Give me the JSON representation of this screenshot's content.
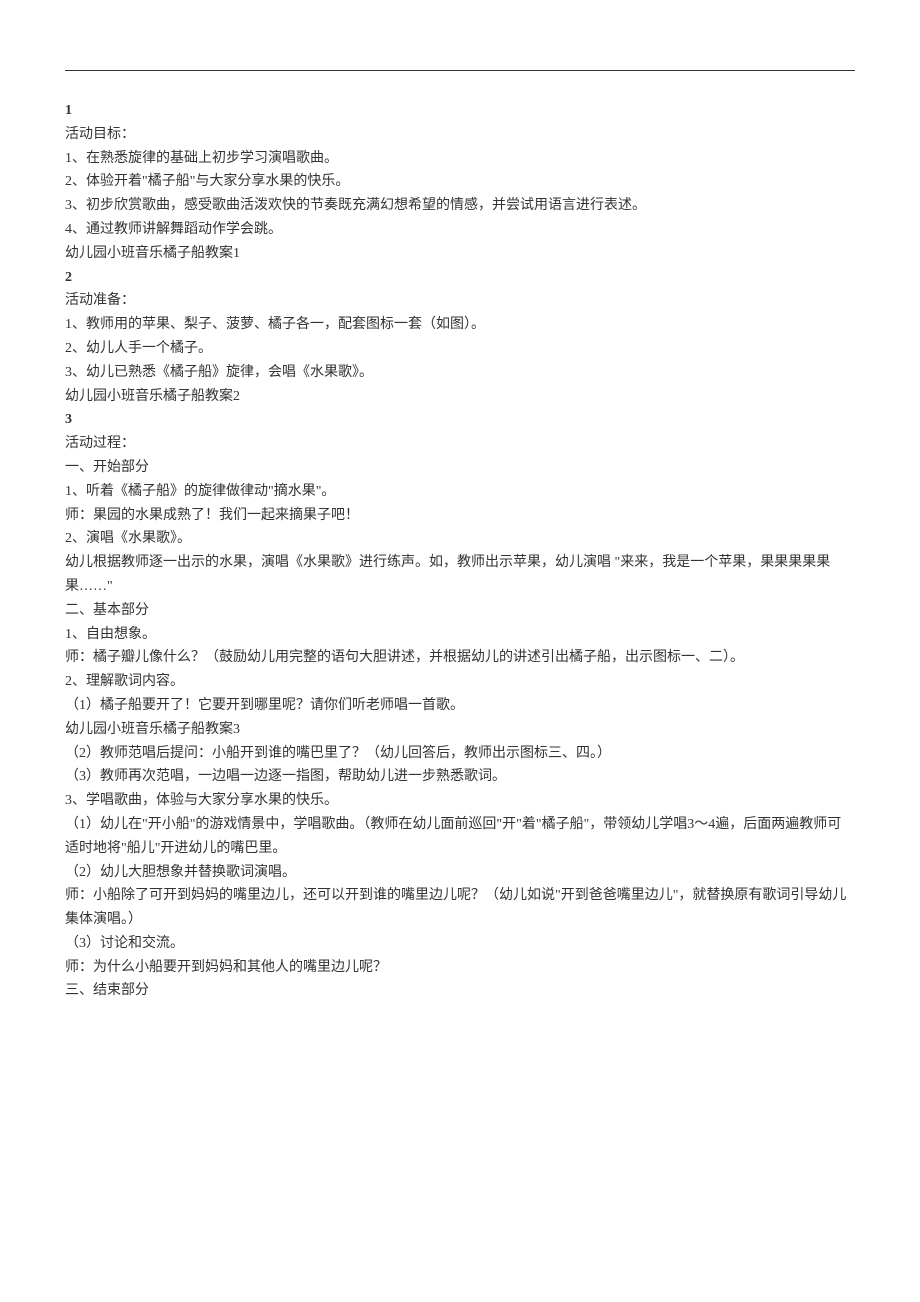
{
  "lines": [
    {
      "cls": "num",
      "text": "1"
    },
    {
      "text": "活动目标："
    },
    {
      "text": "1、在熟悉旋律的基础上初步学习演唱歌曲。"
    },
    {
      "text": "2、体验开着\"橘子船\"与大家分享水果的快乐。"
    },
    {
      "text": "3、初步欣赏歌曲，感受歌曲活泼欢快的节奏既充满幻想希望的情感，并尝试用语言进行表述。"
    },
    {
      "text": "4、通过教师讲解舞蹈动作学会跳。"
    },
    {
      "text": "幼儿园小班音乐橘子船教案1"
    },
    {
      "cls": "num",
      "text": "2"
    },
    {
      "text": "活动准备："
    },
    {
      "text": "1、教师用的苹果、梨子、菠萝、橘子各一，配套图标一套（如图）。"
    },
    {
      "text": "2、幼儿人手一个橘子。"
    },
    {
      "text": "3、幼儿已熟悉《橘子船》旋律，会唱《水果歌》。"
    },
    {
      "text": "幼儿园小班音乐橘子船教案2"
    },
    {
      "cls": "num",
      "text": "3"
    },
    {
      "text": "活动过程："
    },
    {
      "text": "一、开始部分"
    },
    {
      "text": "1、听着《橘子船》的旋律做律动\"摘水果\"。"
    },
    {
      "text": "师：果园的水果成熟了！我们一起来摘果子吧！"
    },
    {
      "text": "2、演唱《水果歌》。"
    },
    {
      "text": "幼儿根据教师逐一出示的水果，演唱《水果歌》进行练声。如，教师出示苹果，幼儿演唱 \"来来，我是一个苹果，果果果果果果……\""
    },
    {
      "text": "二、基本部分"
    },
    {
      "text": "1、自由想象。"
    },
    {
      "text": "师：橘子瓣儿像什么？（鼓励幼儿用完整的语句大胆讲述，并根据幼儿的讲述引出橘子船，出示图标一、二）。"
    },
    {
      "text": "2、理解歌词内容。"
    },
    {
      "text": "（1）橘子船要开了！它要开到哪里呢？请你们听老师唱一首歌。"
    },
    {
      "text": "幼儿园小班音乐橘子船教案3"
    },
    {
      "text": "（2）教师范唱后提问：小船开到谁的嘴巴里了？（幼儿回答后，教师出示图标三、四。）"
    },
    {
      "text": "（3）教师再次范唱，一边唱一边逐一指图，帮助幼儿进一步熟悉歌词。"
    },
    {
      "text": "3、学唱歌曲，体验与大家分享水果的快乐。"
    },
    {
      "text": "（1）幼儿在\"开小船\"的游戏情景中，学唱歌曲。（教师在幼儿面前巡回\"开\"着\"橘子船\"，带领幼儿学唱3～4遍，后面两遍教师可适时地将\"船儿\"开进幼儿的嘴巴里。"
    },
    {
      "text": "（2）幼儿大胆想象并替换歌词演唱。"
    },
    {
      "text": "师：小船除了可开到妈妈的嘴里边儿，还可以开到谁的嘴里边儿呢？（幼儿如说\"开到爸爸嘴里边儿\"，就替换原有歌词引导幼儿集体演唱。）"
    },
    {
      "text": "（3）讨论和交流。"
    },
    {
      "text": "师：为什么小船要开到妈妈和其他人的嘴里边儿呢？"
    },
    {
      "text": "三、结束部分"
    }
  ]
}
